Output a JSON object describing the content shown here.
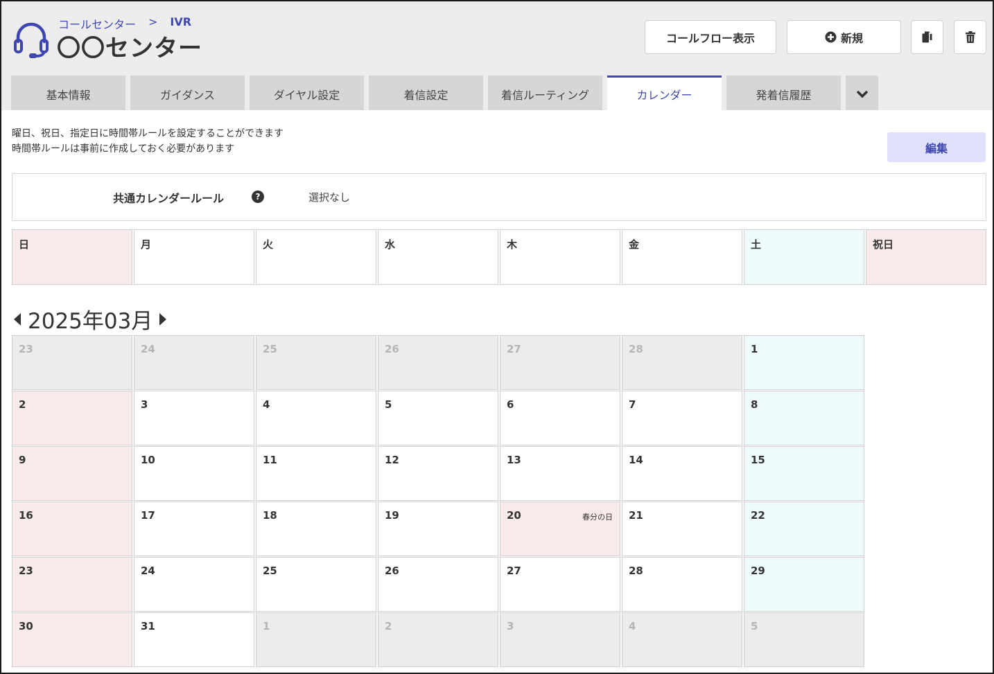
{
  "header": {
    "breadcrumb": [
      "コールセンター",
      ">",
      "IVR"
    ],
    "title": "〇〇センター",
    "icon": "headset-icon",
    "buttons": {
      "callflow": "コールフロー表示",
      "new": "新規",
      "copy_icon": "copy-icon",
      "delete_icon": "trash-icon"
    }
  },
  "tabs": [
    "基本情報",
    "ガイダンス",
    "ダイヤル設定",
    "着信設定",
    "着信ルーティング",
    "カレンダー",
    "発着信履歴"
  ],
  "active_tab": "カレンダー",
  "description": {
    "line1": "曜日、祝日、指定日に時間帯ルールを設定することができます",
    "line2": "時間帯ルールは事前に作成しておく必要があります"
  },
  "edit_label": "編集",
  "common_rule": {
    "label": "共通カレンダールール",
    "help": "?",
    "value": "選択なし"
  },
  "weekdays": [
    "日",
    "月",
    "火",
    "水",
    "木",
    "金",
    "土",
    "祝日"
  ],
  "calendar": {
    "month_label": "2025年03月",
    "weeks": [
      [
        {
          "d": "23",
          "t": "out"
        },
        {
          "d": "24",
          "t": "out"
        },
        {
          "d": "25",
          "t": "out"
        },
        {
          "d": "26",
          "t": "out"
        },
        {
          "d": "27",
          "t": "out"
        },
        {
          "d": "28",
          "t": "out"
        },
        {
          "d": "1",
          "t": "sat"
        }
      ],
      [
        {
          "d": "2",
          "t": "sun"
        },
        {
          "d": "3",
          "t": ""
        },
        {
          "d": "4",
          "t": ""
        },
        {
          "d": "5",
          "t": ""
        },
        {
          "d": "6",
          "t": ""
        },
        {
          "d": "7",
          "t": ""
        },
        {
          "d": "8",
          "t": "sat"
        }
      ],
      [
        {
          "d": "9",
          "t": "sun"
        },
        {
          "d": "10",
          "t": ""
        },
        {
          "d": "11",
          "t": ""
        },
        {
          "d": "12",
          "t": ""
        },
        {
          "d": "13",
          "t": ""
        },
        {
          "d": "14",
          "t": ""
        },
        {
          "d": "15",
          "t": "sat"
        }
      ],
      [
        {
          "d": "16",
          "t": "sun"
        },
        {
          "d": "17",
          "t": ""
        },
        {
          "d": "18",
          "t": ""
        },
        {
          "d": "19",
          "t": ""
        },
        {
          "d": "20",
          "t": "holiday",
          "h": "春分の日"
        },
        {
          "d": "21",
          "t": ""
        },
        {
          "d": "22",
          "t": "sat"
        }
      ],
      [
        {
          "d": "23",
          "t": "sun"
        },
        {
          "d": "24",
          "t": ""
        },
        {
          "d": "25",
          "t": ""
        },
        {
          "d": "26",
          "t": ""
        },
        {
          "d": "27",
          "t": ""
        },
        {
          "d": "28",
          "t": ""
        },
        {
          "d": "29",
          "t": "sat"
        }
      ],
      [
        {
          "d": "30",
          "t": "sun"
        },
        {
          "d": "31",
          "t": ""
        },
        {
          "d": "1",
          "t": "out"
        },
        {
          "d": "2",
          "t": "out"
        },
        {
          "d": "3",
          "t": "out"
        },
        {
          "d": "4",
          "t": "out"
        },
        {
          "d": "5",
          "t": "out"
        }
      ]
    ]
  },
  "colors": {
    "accent": "#3e47b0",
    "sunday_bg": "#f9ebeb",
    "saturday_bg": "#eefcfd",
    "outside_bg": "#ececec",
    "edit_bg": "#dfe1fa"
  }
}
